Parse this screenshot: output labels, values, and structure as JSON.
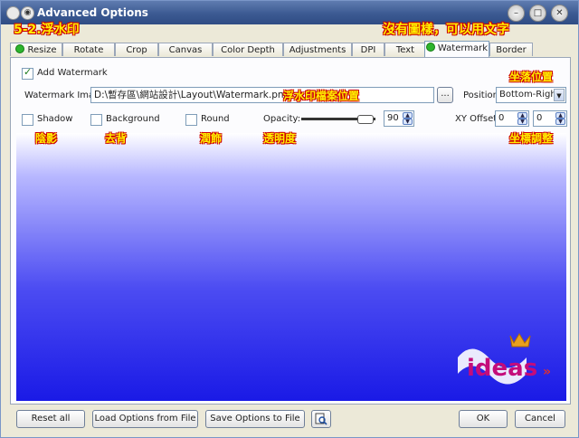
{
  "window": {
    "title": "Advanced Options"
  },
  "annotations": {
    "section_title": "5-2.浮水印",
    "no_image_text_ok": "沒有圖樣，可以用文字",
    "watermark_file_location": "浮水印檔案位置",
    "position_hint": "坐落位置",
    "shadow_hint": "陰影",
    "background_hint": "去背",
    "round_hint": "潤飾",
    "opacity_hint": "透明度",
    "xy_offset_hint": "坐標調整"
  },
  "tabs": [
    "Resize",
    "Rotate",
    "Crop",
    "Canvas",
    "Color Depth",
    "Adjustments",
    "DPI",
    "Text",
    "Watermark",
    "Border"
  ],
  "watermark": {
    "add_label": "Add Watermark",
    "image_label": "Watermark Image:",
    "image_path": "D:\\暫存區\\網站設計\\Layout\\Watermark.png",
    "browse_label": "...",
    "position_label": "Position:",
    "position_value": "Bottom-Right",
    "shadow_label": "Shadow",
    "background_label": "Background",
    "round_label": "Round",
    "opacity_label": "Opacity:",
    "opacity_value": "90",
    "xy_offset_label": "XY Offset:",
    "x_offset": "0",
    "y_offset": "0"
  },
  "logo": {
    "text": "ideas"
  },
  "footer": {
    "reset_label": "Reset all",
    "load_label": "Load Options from File",
    "save_label": "Save Options to File",
    "ok_label": "OK",
    "cancel_label": "Cancel"
  },
  "colors": {
    "active_tab_dot": "#2db52d",
    "annotation_yellow": "#ffef00",
    "annotation_red": "#ff0000",
    "preview_blue": "#1a1ae6"
  }
}
